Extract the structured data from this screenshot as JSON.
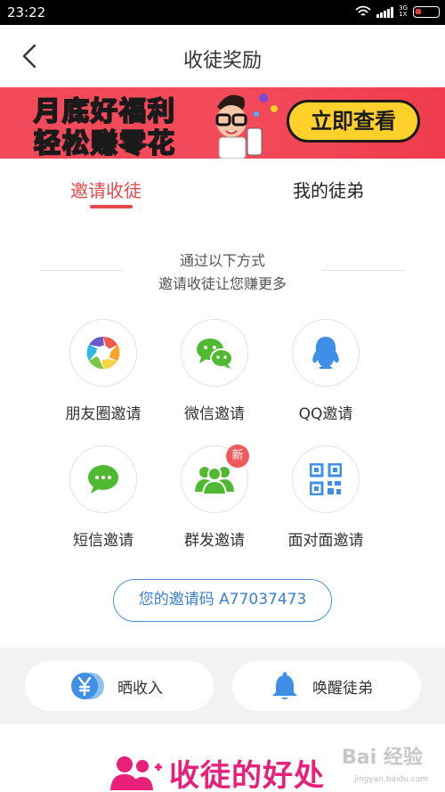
{
  "status_bar": {
    "time": "23:22",
    "network_top": "3G",
    "network_bottom": "1X"
  },
  "header": {
    "title": "收徒奖励",
    "back_icon": "chevron-left-icon"
  },
  "banner": {
    "line1": "月底好福利",
    "line2": "轻松赚零花",
    "button": "立即查看"
  },
  "tabs": [
    {
      "label": "邀请收徒",
      "active": true
    },
    {
      "label": "我的徒弟",
      "active": false
    }
  ],
  "intro": {
    "line1": "通过以下方式",
    "line2": "邀请收徒让您赚更多"
  },
  "share_options": [
    {
      "label": "朋友圈邀请",
      "icon": "moments-aperture-icon"
    },
    {
      "label": "微信邀请",
      "icon": "wechat-icon"
    },
    {
      "label": "QQ邀请",
      "icon": "qq-penguin-icon"
    },
    {
      "label": "短信邀请",
      "icon": "sms-bubble-icon"
    },
    {
      "label": "群发邀请",
      "icon": "group-users-icon",
      "badge": "新"
    },
    {
      "label": "面对面邀请",
      "icon": "qr-code-icon"
    }
  ],
  "invite_code": {
    "text": "您的邀请码 A77037473"
  },
  "actions": [
    {
      "label": "晒收入",
      "icon": "yen-coin-icon"
    },
    {
      "label": "唤醒徒弟",
      "icon": "bell-icon"
    }
  ],
  "footer": {
    "title": "收徒的好处"
  },
  "watermark": {
    "text": "Bai 经验",
    "sub": "jingyan.baidu.com"
  },
  "colors": {
    "accent": "#e84a4a",
    "blue": "#4a90d9",
    "banner_bg": "#f24a5a",
    "footer_pink": "#e8207a"
  }
}
